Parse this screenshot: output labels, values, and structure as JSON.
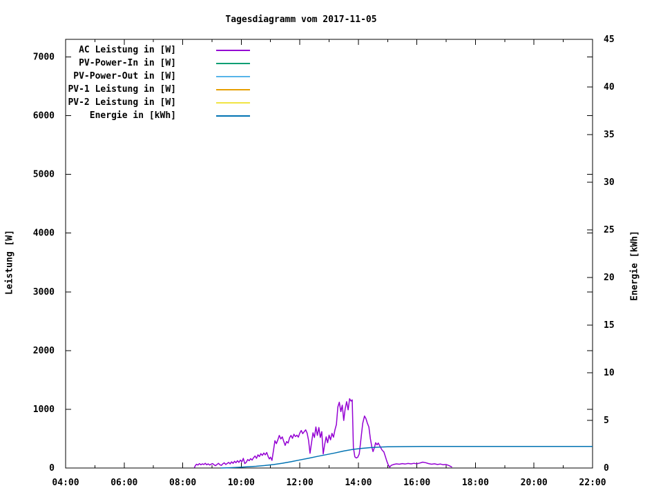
{
  "page": {
    "background": "#ffffff",
    "text_color": "#000000"
  },
  "chart_data": {
    "type": "line",
    "title": "Tagesdiagramm vom 2017-11-05",
    "xlabel": "",
    "ylabel": "Leistung [W]",
    "y2label": "Energie [kWh]",
    "xlim": [
      4,
      22
    ],
    "ylim": [
      0,
      7300
    ],
    "y2lim": [
      0,
      45
    ],
    "grid": false,
    "legend_position": "top-left",
    "xticks": {
      "major_hours": [
        4,
        6,
        8,
        10,
        12,
        14,
        16,
        18,
        20,
        22
      ],
      "minor_hours": [
        5,
        7,
        9,
        11,
        13,
        15,
        17,
        19,
        21
      ],
      "labels": [
        "04:00",
        "06:00",
        "08:00",
        "10:00",
        "12:00",
        "14:00",
        "16:00",
        "18:00",
        "20:00",
        "22:00"
      ]
    },
    "yticks": {
      "values": [
        0,
        1000,
        2000,
        3000,
        4000,
        5000,
        6000,
        7000
      ],
      "labels": [
        "0",
        "1000",
        "2000",
        "3000",
        "4000",
        "5000",
        "6000",
        "7000"
      ]
    },
    "y2ticks": {
      "values": [
        0,
        5,
        10,
        15,
        20,
        25,
        30,
        35,
        40,
        45
      ],
      "labels": [
        "0",
        "5",
        "10",
        "15",
        "20",
        "25",
        "30",
        "35",
        "40",
        "45"
      ]
    },
    "legend": [
      {
        "label": "AC Leistung in [W]",
        "color": "#9400d3"
      },
      {
        "label": "PV-Power-In in [W]",
        "color": "#009e73"
      },
      {
        "label": "PV-Power-Out in [W]",
        "color": "#56b4e9"
      },
      {
        "label": "PV-1 Leistung in [W]",
        "color": "#e69f00"
      },
      {
        "label": "PV-2 Leistung in [W]",
        "color": "#f0e442"
      },
      {
        "label": "Energie in [kWh]",
        "color": "#0072b2"
      }
    ],
    "series": [
      {
        "name": "AC Leistung in [W]",
        "axis": "y1",
        "color": "#9400d3",
        "unit": "W",
        "points": [
          [
            8.4,
            5
          ],
          [
            8.43,
            40
          ],
          [
            8.47,
            65
          ],
          [
            8.52,
            50
          ],
          [
            8.57,
            75
          ],
          [
            8.62,
            55
          ],
          [
            8.67,
            70
          ],
          [
            8.72,
            60
          ],
          [
            8.77,
            80
          ],
          [
            8.82,
            55
          ],
          [
            8.87,
            70
          ],
          [
            8.92,
            50
          ],
          [
            8.97,
            65
          ],
          [
            9.02,
            75
          ],
          [
            9.07,
            55
          ],
          [
            9.12,
            40
          ],
          [
            9.17,
            60
          ],
          [
            9.22,
            80
          ],
          [
            9.27,
            55
          ],
          [
            9.32,
            45
          ],
          [
            9.37,
            70
          ],
          [
            9.42,
            88
          ],
          [
            9.47,
            60
          ],
          [
            9.52,
            78
          ],
          [
            9.57,
            95
          ],
          [
            9.62,
            70
          ],
          [
            9.67,
            105
          ],
          [
            9.72,
            80
          ],
          [
            9.77,
            115
          ],
          [
            9.82,
            90
          ],
          [
            9.87,
            125
          ],
          [
            9.92,
            95
          ],
          [
            9.97,
            135
          ],
          [
            10.02,
            105
          ],
          [
            10.07,
            165
          ],
          [
            10.12,
            75
          ],
          [
            10.17,
            95
          ],
          [
            10.22,
            145
          ],
          [
            10.27,
            125
          ],
          [
            10.32,
            160
          ],
          [
            10.37,
            135
          ],
          [
            10.42,
            175
          ],
          [
            10.47,
            205
          ],
          [
            10.52,
            165
          ],
          [
            10.57,
            225
          ],
          [
            10.62,
            195
          ],
          [
            10.67,
            245
          ],
          [
            10.72,
            215
          ],
          [
            10.77,
            255
          ],
          [
            10.82,
            225
          ],
          [
            10.87,
            265
          ],
          [
            10.92,
            195
          ],
          [
            10.96,
            155
          ],
          [
            11.0,
            185
          ],
          [
            11.05,
            130
          ],
          [
            11.1,
            300
          ],
          [
            11.15,
            465
          ],
          [
            11.2,
            415
          ],
          [
            11.25,
            480
          ],
          [
            11.3,
            555
          ],
          [
            11.35,
            495
          ],
          [
            11.4,
            530
          ],
          [
            11.45,
            455
          ],
          [
            11.5,
            385
          ],
          [
            11.55,
            450
          ],
          [
            11.6,
            425
          ],
          [
            11.65,
            515
          ],
          [
            11.7,
            555
          ],
          [
            11.75,
            505
          ],
          [
            11.8,
            575
          ],
          [
            11.85,
            535
          ],
          [
            11.9,
            560
          ],
          [
            11.95,
            525
          ],
          [
            12.0,
            595
          ],
          [
            12.05,
            640
          ],
          [
            12.1,
            585
          ],
          [
            12.15,
            620
          ],
          [
            12.2,
            650
          ],
          [
            12.25,
            595
          ],
          [
            12.3,
            470
          ],
          [
            12.35,
            250
          ],
          [
            12.4,
            430
          ],
          [
            12.45,
            600
          ],
          [
            12.5,
            520
          ],
          [
            12.55,
            700
          ],
          [
            12.6,
            555
          ],
          [
            12.65,
            690
          ],
          [
            12.7,
            520
          ],
          [
            12.75,
            620
          ],
          [
            12.8,
            240
          ],
          [
            12.85,
            400
          ],
          [
            12.9,
            530
          ],
          [
            12.95,
            430
          ],
          [
            13.0,
            560
          ],
          [
            13.05,
            480
          ],
          [
            13.1,
            590
          ],
          [
            13.15,
            525
          ],
          [
            13.2,
            650
          ],
          [
            13.25,
            740
          ],
          [
            13.3,
            1040
          ],
          [
            13.35,
            1120
          ],
          [
            13.4,
            960
          ],
          [
            13.45,
            1070
          ],
          [
            13.5,
            810
          ],
          [
            13.55,
            1010
          ],
          [
            13.6,
            1130
          ],
          [
            13.65,
            990
          ],
          [
            13.7,
            1180
          ],
          [
            13.75,
            1140
          ],
          [
            13.79,
            1160
          ],
          [
            13.83,
            350
          ],
          [
            13.88,
            190
          ],
          [
            13.93,
            170
          ],
          [
            13.98,
            185
          ],
          [
            14.03,
            240
          ],
          [
            14.09,
            500
          ],
          [
            14.15,
            760
          ],
          [
            14.21,
            885
          ],
          [
            14.26,
            840
          ],
          [
            14.31,
            760
          ],
          [
            14.36,
            700
          ],
          [
            14.41,
            500
          ],
          [
            14.46,
            360
          ],
          [
            14.5,
            280
          ],
          [
            14.55,
            350
          ],
          [
            14.59,
            430
          ],
          [
            14.64,
            395
          ],
          [
            14.68,
            425
          ],
          [
            14.73,
            380
          ],
          [
            14.78,
            330
          ],
          [
            14.82,
            300
          ],
          [
            14.87,
            275
          ],
          [
            14.92,
            200
          ],
          [
            14.97,
            120
          ],
          [
            15.02,
            55
          ],
          [
            15.07,
            15
          ],
          [
            15.12,
            45
          ],
          [
            15.2,
            60
          ],
          [
            15.3,
            70
          ],
          [
            15.4,
            65
          ],
          [
            15.5,
            75
          ],
          [
            15.6,
            68
          ],
          [
            15.7,
            78
          ],
          [
            15.8,
            70
          ],
          [
            15.9,
            80
          ],
          [
            16.0,
            72
          ],
          [
            16.1,
            85
          ],
          [
            16.2,
            100
          ],
          [
            16.3,
            90
          ],
          [
            16.4,
            75
          ],
          [
            16.5,
            65
          ],
          [
            16.6,
            72
          ],
          [
            16.7,
            60
          ],
          [
            16.8,
            68
          ],
          [
            16.9,
            55
          ],
          [
            17.0,
            60
          ],
          [
            17.1,
            40
          ],
          [
            17.2,
            15
          ]
        ]
      },
      {
        "name": "Energie in [kWh]",
        "axis": "y2",
        "color": "#0072b2",
        "unit": "kWh",
        "points": [
          [
            9.3,
            0.0
          ],
          [
            9.6,
            0.03
          ],
          [
            9.9,
            0.07
          ],
          [
            10.2,
            0.12
          ],
          [
            10.5,
            0.18
          ],
          [
            10.8,
            0.26
          ],
          [
            11.1,
            0.36
          ],
          [
            11.4,
            0.5
          ],
          [
            11.7,
            0.66
          ],
          [
            12.0,
            0.85
          ],
          [
            12.3,
            1.02
          ],
          [
            12.6,
            1.22
          ],
          [
            12.9,
            1.4
          ],
          [
            13.2,
            1.58
          ],
          [
            13.5,
            1.78
          ],
          [
            13.8,
            1.95
          ],
          [
            14.1,
            2.06
          ],
          [
            14.4,
            2.14
          ],
          [
            14.7,
            2.19
          ],
          [
            15.0,
            2.23
          ],
          [
            15.5,
            2.25
          ],
          [
            16.2,
            2.27
          ],
          [
            22.0,
            2.27
          ]
        ]
      }
    ]
  }
}
